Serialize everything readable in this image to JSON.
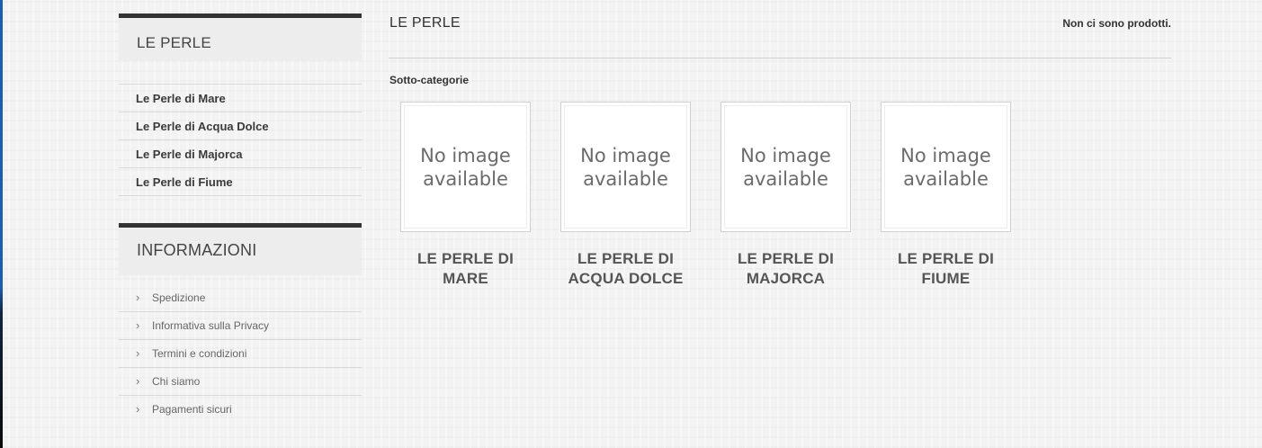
{
  "sidebar": {
    "categories_title": "LE PERLE",
    "categories": [
      {
        "label": "Le Perle di Mare"
      },
      {
        "label": "Le Perle di Acqua Dolce"
      },
      {
        "label": "Le Perle di Majorca"
      },
      {
        "label": "Le Perle di Fiume"
      }
    ],
    "info_title": "INFORMAZIONI",
    "info_links": [
      {
        "label": "Spedizione"
      },
      {
        "label": "Informativa sulla Privacy"
      },
      {
        "label": "Termini e condizioni"
      },
      {
        "label": "Chi siamo"
      },
      {
        "label": "Pagamenti sicuri"
      }
    ],
    "chevron": "›"
  },
  "main": {
    "title": "LE PERLE",
    "no_products": "Non ci sono prodotti.",
    "subcategories_heading": "Sotto-categorie",
    "subcategories": [
      {
        "name": "LE PERLE DI MARE",
        "image_text": "No image available"
      },
      {
        "name": "LE PERLE DI ACQUA DOLCE",
        "image_text": "No image available"
      },
      {
        "name": "LE PERLE DI MAJORCA",
        "image_text": "No image available"
      },
      {
        "name": "LE PERLE DI FIUME",
        "image_text": "No image available"
      }
    ]
  },
  "colors": {
    "block_border": "#333333",
    "block_head_bg": "#ededed",
    "page_bg": "#f3f3f3",
    "desktop_edge": "#1a5fb4"
  }
}
